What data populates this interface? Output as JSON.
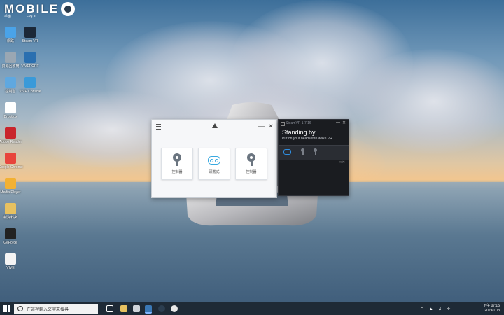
{
  "brand": {
    "logo_text": "MOBILE",
    "sub_left": "手機",
    "sub_right": "Log in"
  },
  "desktop_icons": [
    {
      "label": "網路",
      "icon": "network-icon",
      "color": "#4aa3e8",
      "col": 0,
      "row": 0
    },
    {
      "label": "Steam VR",
      "icon": "steam-icon",
      "color": "#1b2838",
      "col": 1,
      "row": 0
    },
    {
      "label": "資源回收筒",
      "icon": "recycle-bin-icon",
      "color": "#9aa7b3",
      "col": 0,
      "row": 1
    },
    {
      "label": "VIVEPORT",
      "icon": "viveport-icon",
      "color": "#2a6fb0",
      "col": 1,
      "row": 1
    },
    {
      "label": "控制台",
      "icon": "control-panel-icon",
      "color": "#5fa8e0",
      "col": 0,
      "row": 2
    },
    {
      "label": "VIVE Console",
      "icon": "vive-console-icon",
      "color": "#3a9ad9",
      "col": 1,
      "row": 2
    },
    {
      "label": "Dropbox",
      "icon": "dropbox-icon",
      "color": "#ffffff",
      "col": 0,
      "row": 3
    },
    {
      "label": "Adobe Reader",
      "icon": "adobe-reader-icon",
      "color": "#c9252c",
      "col": 0,
      "row": 4
    },
    {
      "label": "Google Chrome",
      "icon": "chrome-icon",
      "color": "#e8453c",
      "col": 0,
      "row": 5
    },
    {
      "label": "Media Player",
      "icon": "media-player-icon",
      "color": "#f2b134",
      "col": 0,
      "row": 6
    },
    {
      "label": "新資料夾",
      "icon": "folder-icon",
      "color": "#e7c160",
      "col": 0,
      "row": 7
    },
    {
      "label": "GeForce",
      "icon": "geforce-icon",
      "color": "#222222",
      "col": 0,
      "row": 8
    },
    {
      "label": "VIVE",
      "icon": "document-icon",
      "color": "#f4f4f4",
      "col": 0,
      "row": 9
    }
  ],
  "vive_window": {
    "devices": [
      {
        "label": "控制器",
        "type": "controller"
      },
      {
        "label": "頭戴式",
        "type": "headset"
      },
      {
        "label": "控制器",
        "type": "controller"
      }
    ]
  },
  "steamvr_window": {
    "title": "SteamVR 1.7.16",
    "status_title": "Standing by",
    "status_subtitle": "Put on your headset to wake VR"
  },
  "taskbar": {
    "search_placeholder": "在這裡輸入文字來搜尋",
    "time": "下午 07:15",
    "date": "2019/11/3"
  }
}
